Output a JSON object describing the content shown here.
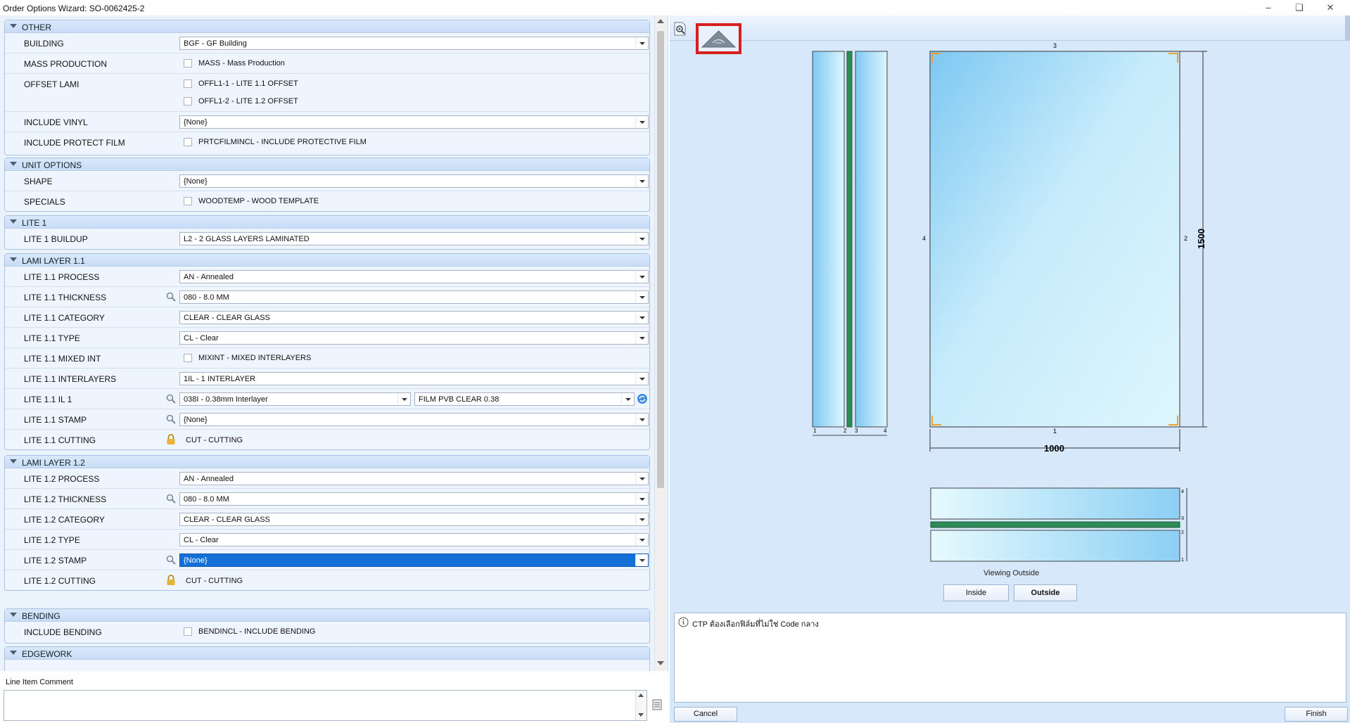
{
  "window": {
    "title": "Order Options Wizard: SO-0062425-2"
  },
  "groups": {
    "other": {
      "title": "OTHER",
      "building": {
        "label": "BUILDING",
        "value": "BGF - GF Building"
      },
      "mass_production": {
        "label": "MASS PRODUCTION",
        "option": "MASS - Mass Production"
      },
      "offset_lami": {
        "label": "OFFSET LAMI",
        "option1": "OFFL1-1 - LITE 1.1 OFFSET",
        "option2": "OFFL1-2 - LITE 1.2 OFFSET"
      },
      "include_vinyl": {
        "label": "INCLUDE VINYL",
        "value": "{None}"
      },
      "include_protect_film": {
        "label": "INCLUDE PROTECT FILM",
        "option": "PRTCFILMINCL - INCLUDE PROTECTIVE FILM"
      }
    },
    "unit_options": {
      "title": "UNIT OPTIONS",
      "shape": {
        "label": "SHAPE",
        "value": "{None}"
      },
      "specials": {
        "label": "SPECIALS",
        "option": "WOODTEMP - WOOD TEMPLATE"
      }
    },
    "lite1": {
      "title": "LITE 1",
      "buildup": {
        "label": "LITE 1 BUILDUP",
        "value": "L2 - 2 GLASS LAYERS LAMINATED"
      }
    },
    "lami11": {
      "title": "LAMI LAYER 1.1",
      "process": {
        "label": "LITE 1.1 PROCESS",
        "value": "AN - Annealed"
      },
      "thickness": {
        "label": "LITE 1.1 THICKNESS",
        "value": "080 - 8.0 MM"
      },
      "category": {
        "label": "LITE 1.1 CATEGORY",
        "value": "CLEAR - CLEAR GLASS"
      },
      "type": {
        "label": "LITE 1.1 TYPE",
        "value": "CL - Clear"
      },
      "mixed_int": {
        "label": "LITE 1.1 MIXED INT",
        "option": "MIXINT - MIXED INTERLAYERS"
      },
      "interlayers": {
        "label": "LITE 1.1 INTERLAYERS",
        "value": "1IL - 1 INTERLAYER"
      },
      "il1": {
        "label": "LITE 1.1 IL 1",
        "value": "038I - 0.38mm Interlayer",
        "value2": "FILM PVB CLEAR 0.38"
      },
      "stamp": {
        "label": "LITE 1.1 STAMP",
        "value": "{None}"
      },
      "cutting": {
        "label": "LITE 1.1 CUTTING",
        "value": "CUT - CUTTING"
      }
    },
    "lami12": {
      "title": "LAMI LAYER 1.2",
      "process": {
        "label": "LITE 1.2 PROCESS",
        "value": "AN - Annealed"
      },
      "thickness": {
        "label": "LITE 1.2 THICKNESS",
        "value": "080 - 8.0 MM"
      },
      "category": {
        "label": "LITE 1.2 CATEGORY",
        "value": "CLEAR - CLEAR GLASS"
      },
      "type": {
        "label": "LITE 1.2 TYPE",
        "value": "CL - Clear"
      },
      "stamp": {
        "label": "LITE 1.2 STAMP",
        "value": "{None}"
      },
      "cutting": {
        "label": "LITE 1.2 CUTTING",
        "value": "CUT - CUTTING"
      }
    },
    "bending": {
      "title": "BENDING",
      "include_bending": {
        "label": "INCLUDE BENDING",
        "option": "BENDINCL - INCLUDE BENDING"
      }
    },
    "edgework": {
      "title": "EDGEWORK"
    }
  },
  "comment": {
    "label": "Line Item Comment",
    "value": ""
  },
  "preview": {
    "width_dim": "1000",
    "height_dim": "1500",
    "edge_top": "3",
    "edge_bottom": "1",
    "edge_left": "4",
    "edge_right": "2",
    "side_labels": [
      "1",
      "2",
      "3",
      "4"
    ],
    "viewing_label": "Viewing Outside",
    "inside_button": "Inside",
    "outside_button": "Outside",
    "colors": {
      "glass": "#bfe6fb",
      "interlayer": "#2e8b57",
      "corner_marker": "#f0a030"
    }
  },
  "message": "CTP ต้องเลือกฟิล์มที่ไม่ใช่ Code กลาง",
  "footer": {
    "cancel": "Cancel",
    "finish": "Finish"
  }
}
